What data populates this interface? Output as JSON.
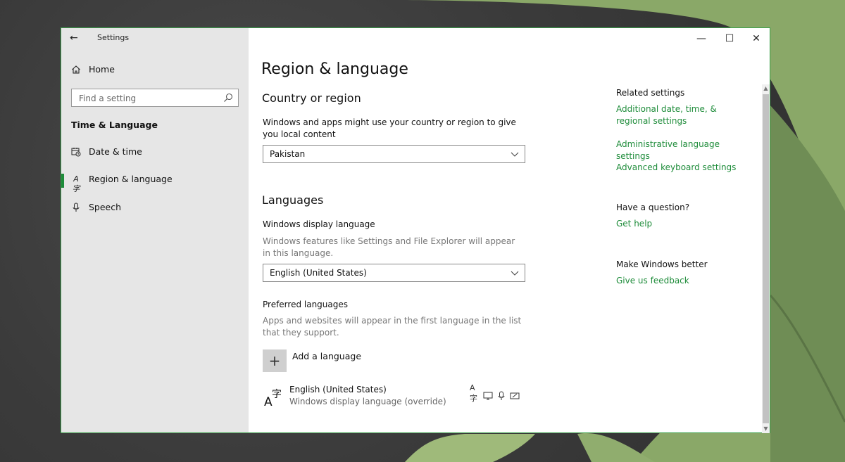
{
  "window": {
    "app_title": "Settings",
    "back_icon": "back-arrow-icon",
    "controls": {
      "minimize": "—",
      "maximize": "☐",
      "close": "✕"
    }
  },
  "sidebar": {
    "home_label": "Home",
    "search_placeholder": "Find a setting",
    "section_header": "Time & Language",
    "items": [
      {
        "label": "Date & time",
        "icon": "calendar-clock-icon",
        "selected": false
      },
      {
        "label": "Region & language",
        "icon": "language-icon",
        "selected": true
      },
      {
        "label": "Speech",
        "icon": "microphone-icon",
        "selected": false
      }
    ]
  },
  "main": {
    "page_title": "Region & language",
    "country": {
      "heading": "Country or region",
      "description": "Windows and apps might use your country or region to give you local content",
      "selected": "Pakistan"
    },
    "languages": {
      "heading": "Languages",
      "display_label": "Windows display language",
      "display_desc": "Windows features like Settings and File Explorer will appear in this language.",
      "display_selected": "English (United States)",
      "preferred_label": "Preferred languages",
      "preferred_desc": "Apps and websites will appear in the first language in the list that they support.",
      "add_label": "Add a language",
      "list": [
        {
          "name": "English (United States)",
          "subtitle": "Windows display language (override)",
          "feature_icons": [
            "language-pack-icon",
            "display-icon",
            "speech-icon",
            "handwriting-icon"
          ]
        }
      ]
    }
  },
  "related": {
    "heading": "Related settings",
    "links": [
      "Additional date, time, & regional settings",
      "Administrative language settings",
      "Advanced keyboard settings"
    ],
    "question_heading": "Have a question?",
    "help_link": "Get help",
    "better_heading": "Make Windows better",
    "feedback_link": "Give us feedback"
  },
  "colors": {
    "accent": "#1e8c3a",
    "sidebar_bg": "#e6e6e6",
    "window_border": "#3aa14a"
  }
}
